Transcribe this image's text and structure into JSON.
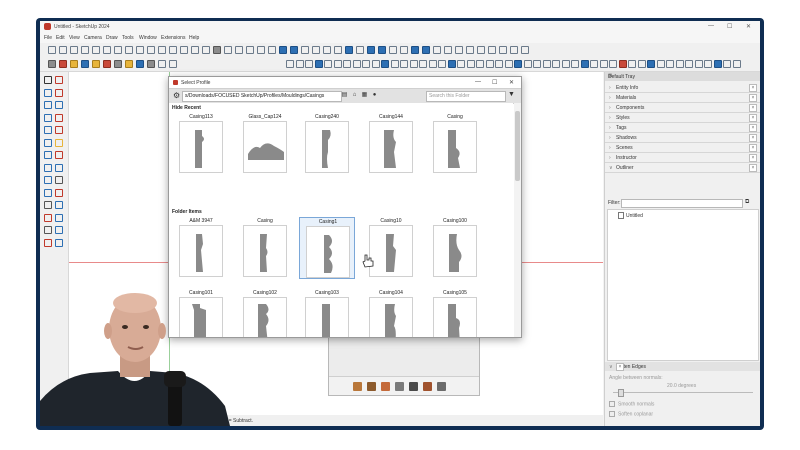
{
  "app": {
    "title": "Untitled - SketchUp 2024",
    "window_controls": [
      "—",
      "☐",
      "✕"
    ]
  },
  "menu": [
    "File",
    "Edit",
    "View",
    "Camera",
    "Draw",
    "Tools",
    "Window",
    "Extensions",
    "Help"
  ],
  "dialog": {
    "title": "Select Profile",
    "path": "s/Downloads/FOCUSED SketchUp/Profiles/Mouldings/Casings",
    "search_placeholder": "Search this Folder",
    "sections": [
      {
        "label": "Hide Recent",
        "items": [
          "Casing113",
          "Glass_Cap124",
          "Casing240",
          "Casing144",
          "Casing"
        ]
      },
      {
        "label": "Folder Items",
        "items": [
          "A&M 3947",
          "Casing",
          "Casing1",
          "Casing10",
          "Casing100"
        ]
      },
      {
        "label": "",
        "items": [
          "Casing101",
          "Casing102",
          "Casing103",
          "Casing104",
          "Casing105"
        ]
      }
    ],
    "selected_item": "Casing1"
  },
  "tray": {
    "title": "Default Tray",
    "panels": [
      "Entity Info",
      "Materials",
      "Components",
      "Styles",
      "Tags",
      "Shadows",
      "Scenes",
      "Instructor",
      "Outliner"
    ],
    "filter_label": "Filter:",
    "outliner_item": "Untitled",
    "soften": {
      "title": "Soften Edges",
      "angle_label": "Angle between normals:",
      "degrees": "20.0",
      "degrees_unit": "degrees",
      "smooth_label": "Smooth normals",
      "coplanar_label": "Soften coplanar"
    }
  },
  "status": {
    "text": "Ctrl = Add, Shift + Ctrl = Subtract."
  },
  "colors": {
    "frame": "#0f2d52",
    "toolbar_blue": "#2d6fb3",
    "axis_red": "#e88a8a",
    "axis_green": "#9bd09b",
    "profile_grey": "#8a8a8a",
    "selection": "#7aa7d8"
  }
}
